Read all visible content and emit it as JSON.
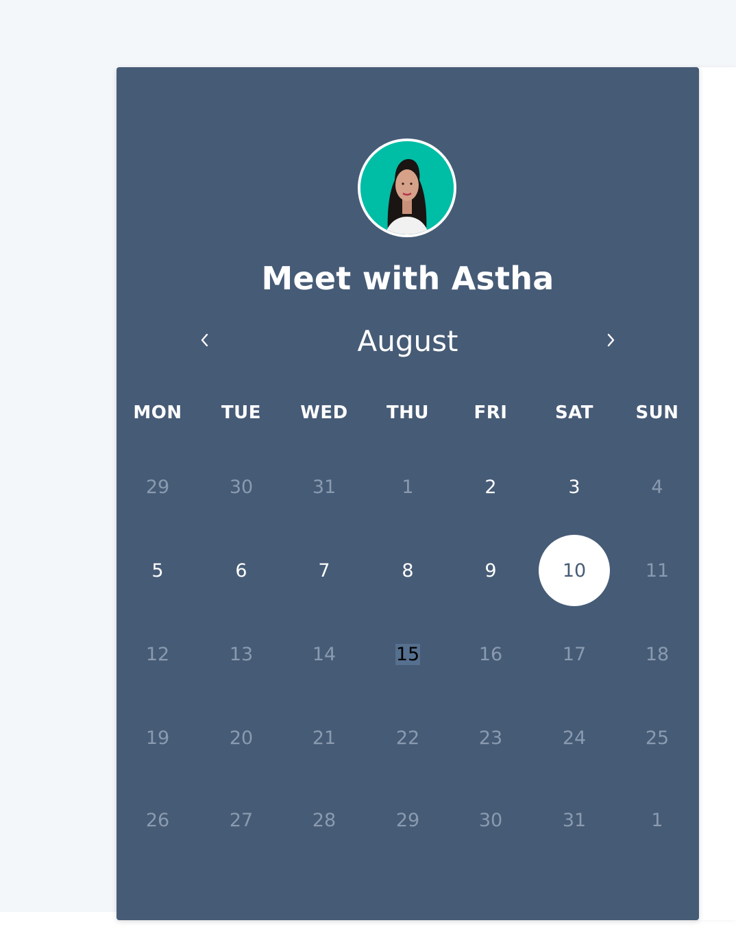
{
  "scheduler": {
    "avatar_icon": "person-avatar",
    "title": "Meet with Astha",
    "month": "August",
    "prev_icon": "chevron-left-icon",
    "next_icon": "chevron-right-icon",
    "weekdays": [
      "MON",
      "TUE",
      "WED",
      "THU",
      "FRI",
      "SAT",
      "SUN"
    ],
    "weeks": [
      [
        {
          "label": "29",
          "state": "muted"
        },
        {
          "label": "30",
          "state": "muted"
        },
        {
          "label": "31",
          "state": "muted"
        },
        {
          "label": "1",
          "state": "muted"
        },
        {
          "label": "2",
          "state": "available"
        },
        {
          "label": "3",
          "state": "available"
        },
        {
          "label": "4",
          "state": "muted"
        }
      ],
      [
        {
          "label": "5",
          "state": "available"
        },
        {
          "label": "6",
          "state": "available"
        },
        {
          "label": "7",
          "state": "available"
        },
        {
          "label": "8",
          "state": "available"
        },
        {
          "label": "9",
          "state": "available"
        },
        {
          "label": "10",
          "state": "selected"
        },
        {
          "label": "11",
          "state": "muted"
        }
      ],
      [
        {
          "label": "12",
          "state": "muted"
        },
        {
          "label": "13",
          "state": "muted"
        },
        {
          "label": "14",
          "state": "muted"
        },
        {
          "label": "15",
          "state": "today"
        },
        {
          "label": "16",
          "state": "muted"
        },
        {
          "label": "17",
          "state": "muted"
        },
        {
          "label": "18",
          "state": "muted"
        }
      ],
      [
        {
          "label": "19",
          "state": "muted"
        },
        {
          "label": "20",
          "state": "muted"
        },
        {
          "label": "21",
          "state": "muted"
        },
        {
          "label": "22",
          "state": "muted"
        },
        {
          "label": "23",
          "state": "muted"
        },
        {
          "label": "24",
          "state": "muted"
        },
        {
          "label": "25",
          "state": "muted"
        }
      ],
      [
        {
          "label": "26",
          "state": "muted"
        },
        {
          "label": "27",
          "state": "muted"
        },
        {
          "label": "28",
          "state": "muted"
        },
        {
          "label": "29",
          "state": "muted"
        },
        {
          "label": "30",
          "state": "muted"
        },
        {
          "label": "31",
          "state": "muted"
        },
        {
          "label": "1",
          "state": "muted"
        }
      ]
    ]
  },
  "colors": {
    "card_bg": "#465b76",
    "page_bg": "#f4f7fa",
    "avatar_bg": "#00bda5",
    "muted_text": "#8a9bb0",
    "today_highlight": "#56708f"
  }
}
